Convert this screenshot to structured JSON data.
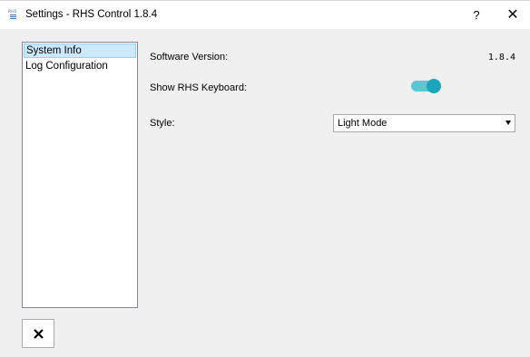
{
  "window": {
    "title": "Settings - RHS Control 1.8.4",
    "help_label": "?",
    "close_label": "✕"
  },
  "nav": {
    "items": [
      {
        "label": "System Info",
        "selected": true
      },
      {
        "label": "Log Configuration",
        "selected": false
      }
    ]
  },
  "system_info": {
    "software_version_label": "Software Version:",
    "software_version_value": "1.8.4",
    "show_keyboard_label": "Show RHS Keyboard:",
    "show_keyboard_enabled": true,
    "style_label": "Style:",
    "style_value": "Light Mode"
  },
  "footer": {
    "close_icon": "x-icon"
  },
  "colors": {
    "toggle_track": "#5cc6d3",
    "toggle_knob": "#1aa5bb",
    "selection_bg": "#cce8ff",
    "selection_border": "#99d1ff"
  }
}
